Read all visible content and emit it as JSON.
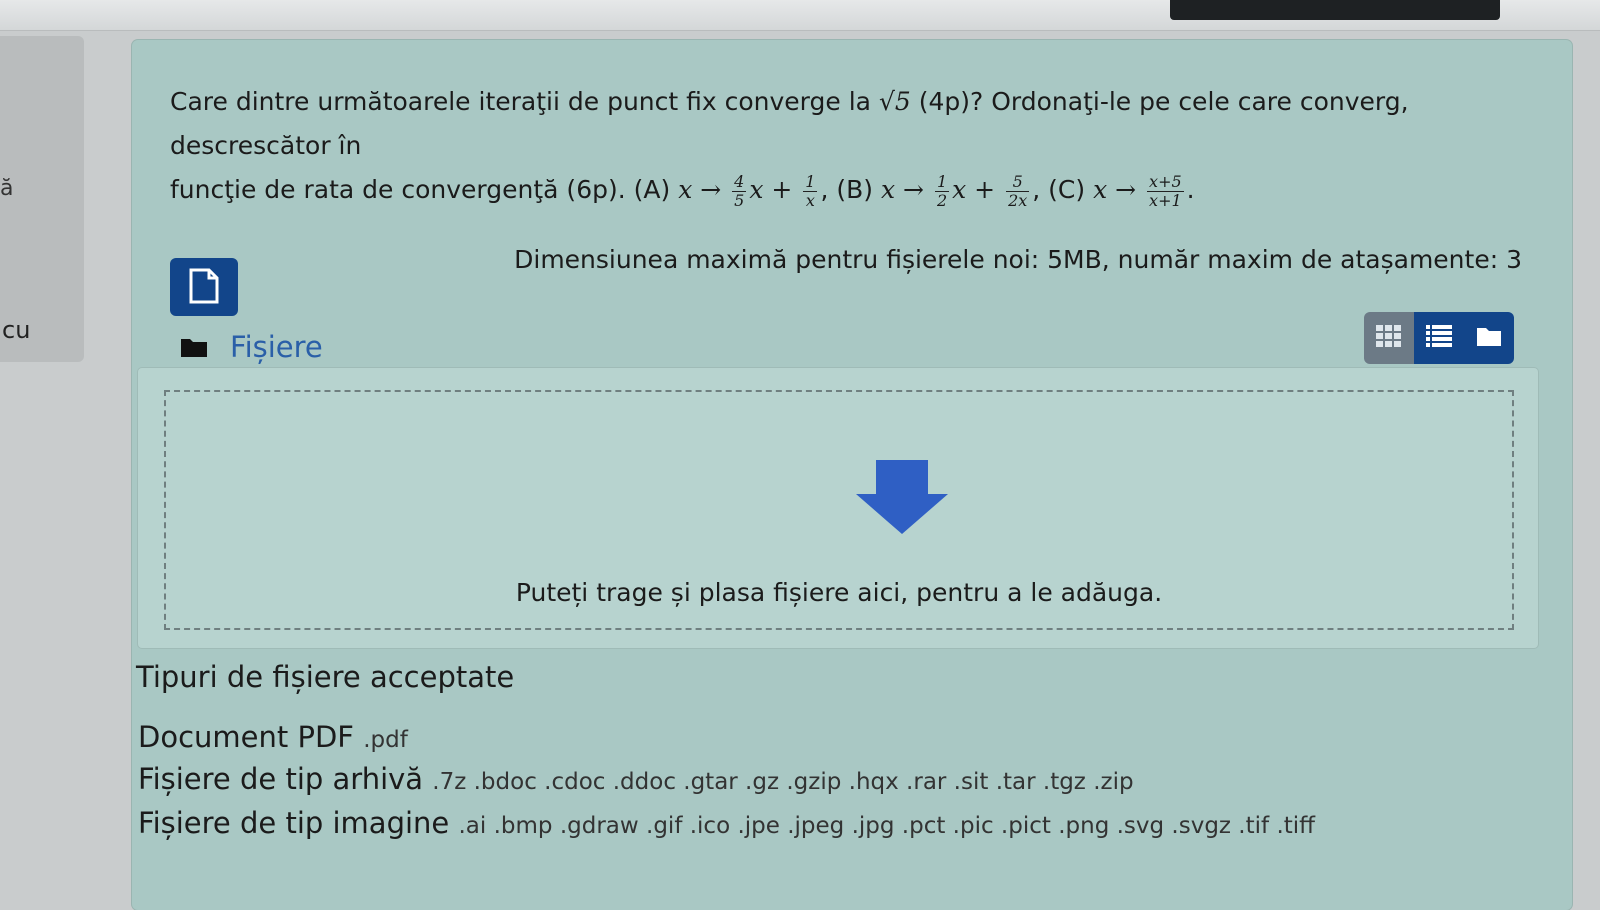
{
  "left_panel": {
    "edge_text_a": "ă",
    "edge_text_b": "cu"
  },
  "question": {
    "line1": "Care dintre următoarele iteraţii de punct fix converge la",
    "sqrt": "√5",
    "after_sqrt": "(4p)? Ordonaţi-le pe cele care converg, descrescător în",
    "line2_start": "funcţie de rata de convergenţă (6p). (A)",
    "a_map": "x →",
    "a_frac1_num": "4",
    "a_frac1_den": "5",
    "a_mid": "x +",
    "a_frac2_num": "1",
    "a_frac2_den": "x",
    "b_label": ", (B)",
    "b_map": "x →",
    "b_frac1_num": "1",
    "b_frac1_den": "2",
    "b_mid": "x +",
    "b_frac2_num": "5",
    "b_frac2_den": "2x",
    "c_label": ", (C)",
    "c_map": "x →",
    "c_frac_num": "x+5",
    "c_frac_den": "x+1",
    "end": "."
  },
  "limits_text": "Dimensiunea maximă pentru fișierele noi: 5MB, număr maxim de atașamente: 3",
  "files": {
    "folder_label": "Fișiere",
    "drop_text": "Puteți trage și plasa fișiere aici, pentru a le adăuga.",
    "view_buttons": [
      "grid-view",
      "list-view",
      "tree-view"
    ]
  },
  "accepted": {
    "title": "Tipuri de fișiere acceptate",
    "types": [
      {
        "name": "Document PDF",
        "ext": ".pdf"
      },
      {
        "name": "Fișiere de tip arhivă",
        "ext": ".7z .bdoc .cdoc .ddoc .gtar .gz .gzip .hqx .rar .sit .tar .tgz .zip"
      },
      {
        "name": "Fișiere de tip imagine",
        "ext": ".ai .bmp .gdraw .gif .ico .jpe .jpeg .jpg .pct .pic .pict .png .svg .svgz .tif .tiff"
      }
    ]
  },
  "colors": {
    "primary": "#12458a",
    "card_bg": "#a9c8c4",
    "link": "#2a5fa8",
    "arrow": "#2f5fc4"
  }
}
